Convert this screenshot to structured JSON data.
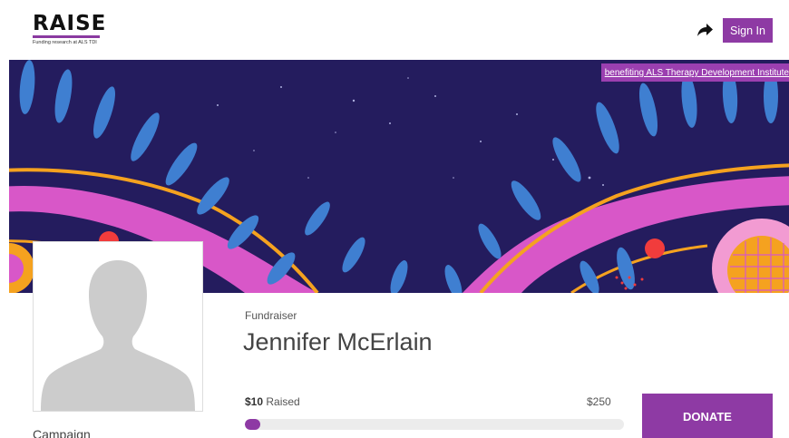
{
  "header": {
    "logo_text": "RAISE",
    "logo_tagline": "Funding research at ALS TDI",
    "share_icon": "share-arrow-icon",
    "signin_label": "Sign In"
  },
  "banner": {
    "benefiting_text": "benefiting ALS Therapy Development Institute"
  },
  "profile": {
    "avatar_icon": "person-silhouette-icon",
    "type_label": "Fundraiser",
    "name": "Jennifer McErlain",
    "campaign_label": "Campaign"
  },
  "progress": {
    "raised_amount": "$10",
    "raised_label": " Raised",
    "goal": "$250",
    "fraction": 0.04
  },
  "donate_label": "DONATE",
  "colors": {
    "brand_purple": "#8e3aa4",
    "banner_navy": "#241c5e",
    "banner_blue": "#3f7fd1",
    "banner_pink": "#d857c8",
    "banner_orange": "#f5a21f",
    "banner_red": "#f13c3c"
  }
}
